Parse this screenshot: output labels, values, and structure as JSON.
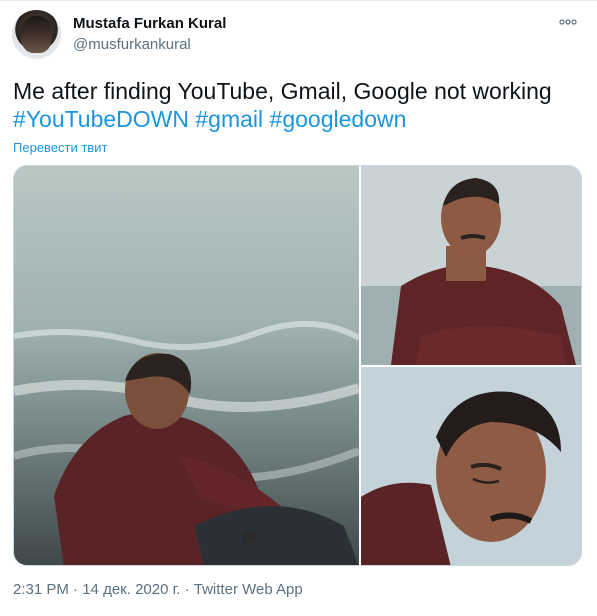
{
  "author": {
    "display_name": "Mustafa Furkan Kural",
    "handle": "@musfurkankural"
  },
  "tweet": {
    "text_line1": "Me after finding YouTube, Gmail, Google not working",
    "hashtags": [
      "#YouTubeDOWN",
      "#gmail",
      "#googledown"
    ],
    "translate_label": "Перевести твит"
  },
  "media": {
    "photos": [
      {
        "label": "man sitting by the sea, looking up"
      },
      {
        "label": "man looking up with arms crossed"
      },
      {
        "label": "man looking down sadly"
      }
    ]
  },
  "meta": {
    "time": "2:31 PM",
    "date": "14 дек. 2020 г.",
    "separator": "·",
    "source": "Twitter Web App"
  },
  "colors": {
    "link": "#1b95e0",
    "secondary_text": "#5b7083",
    "primary_text": "#0f1419",
    "border": "#ccd6dd"
  },
  "icons": {
    "more": "more-dots-icon"
  }
}
